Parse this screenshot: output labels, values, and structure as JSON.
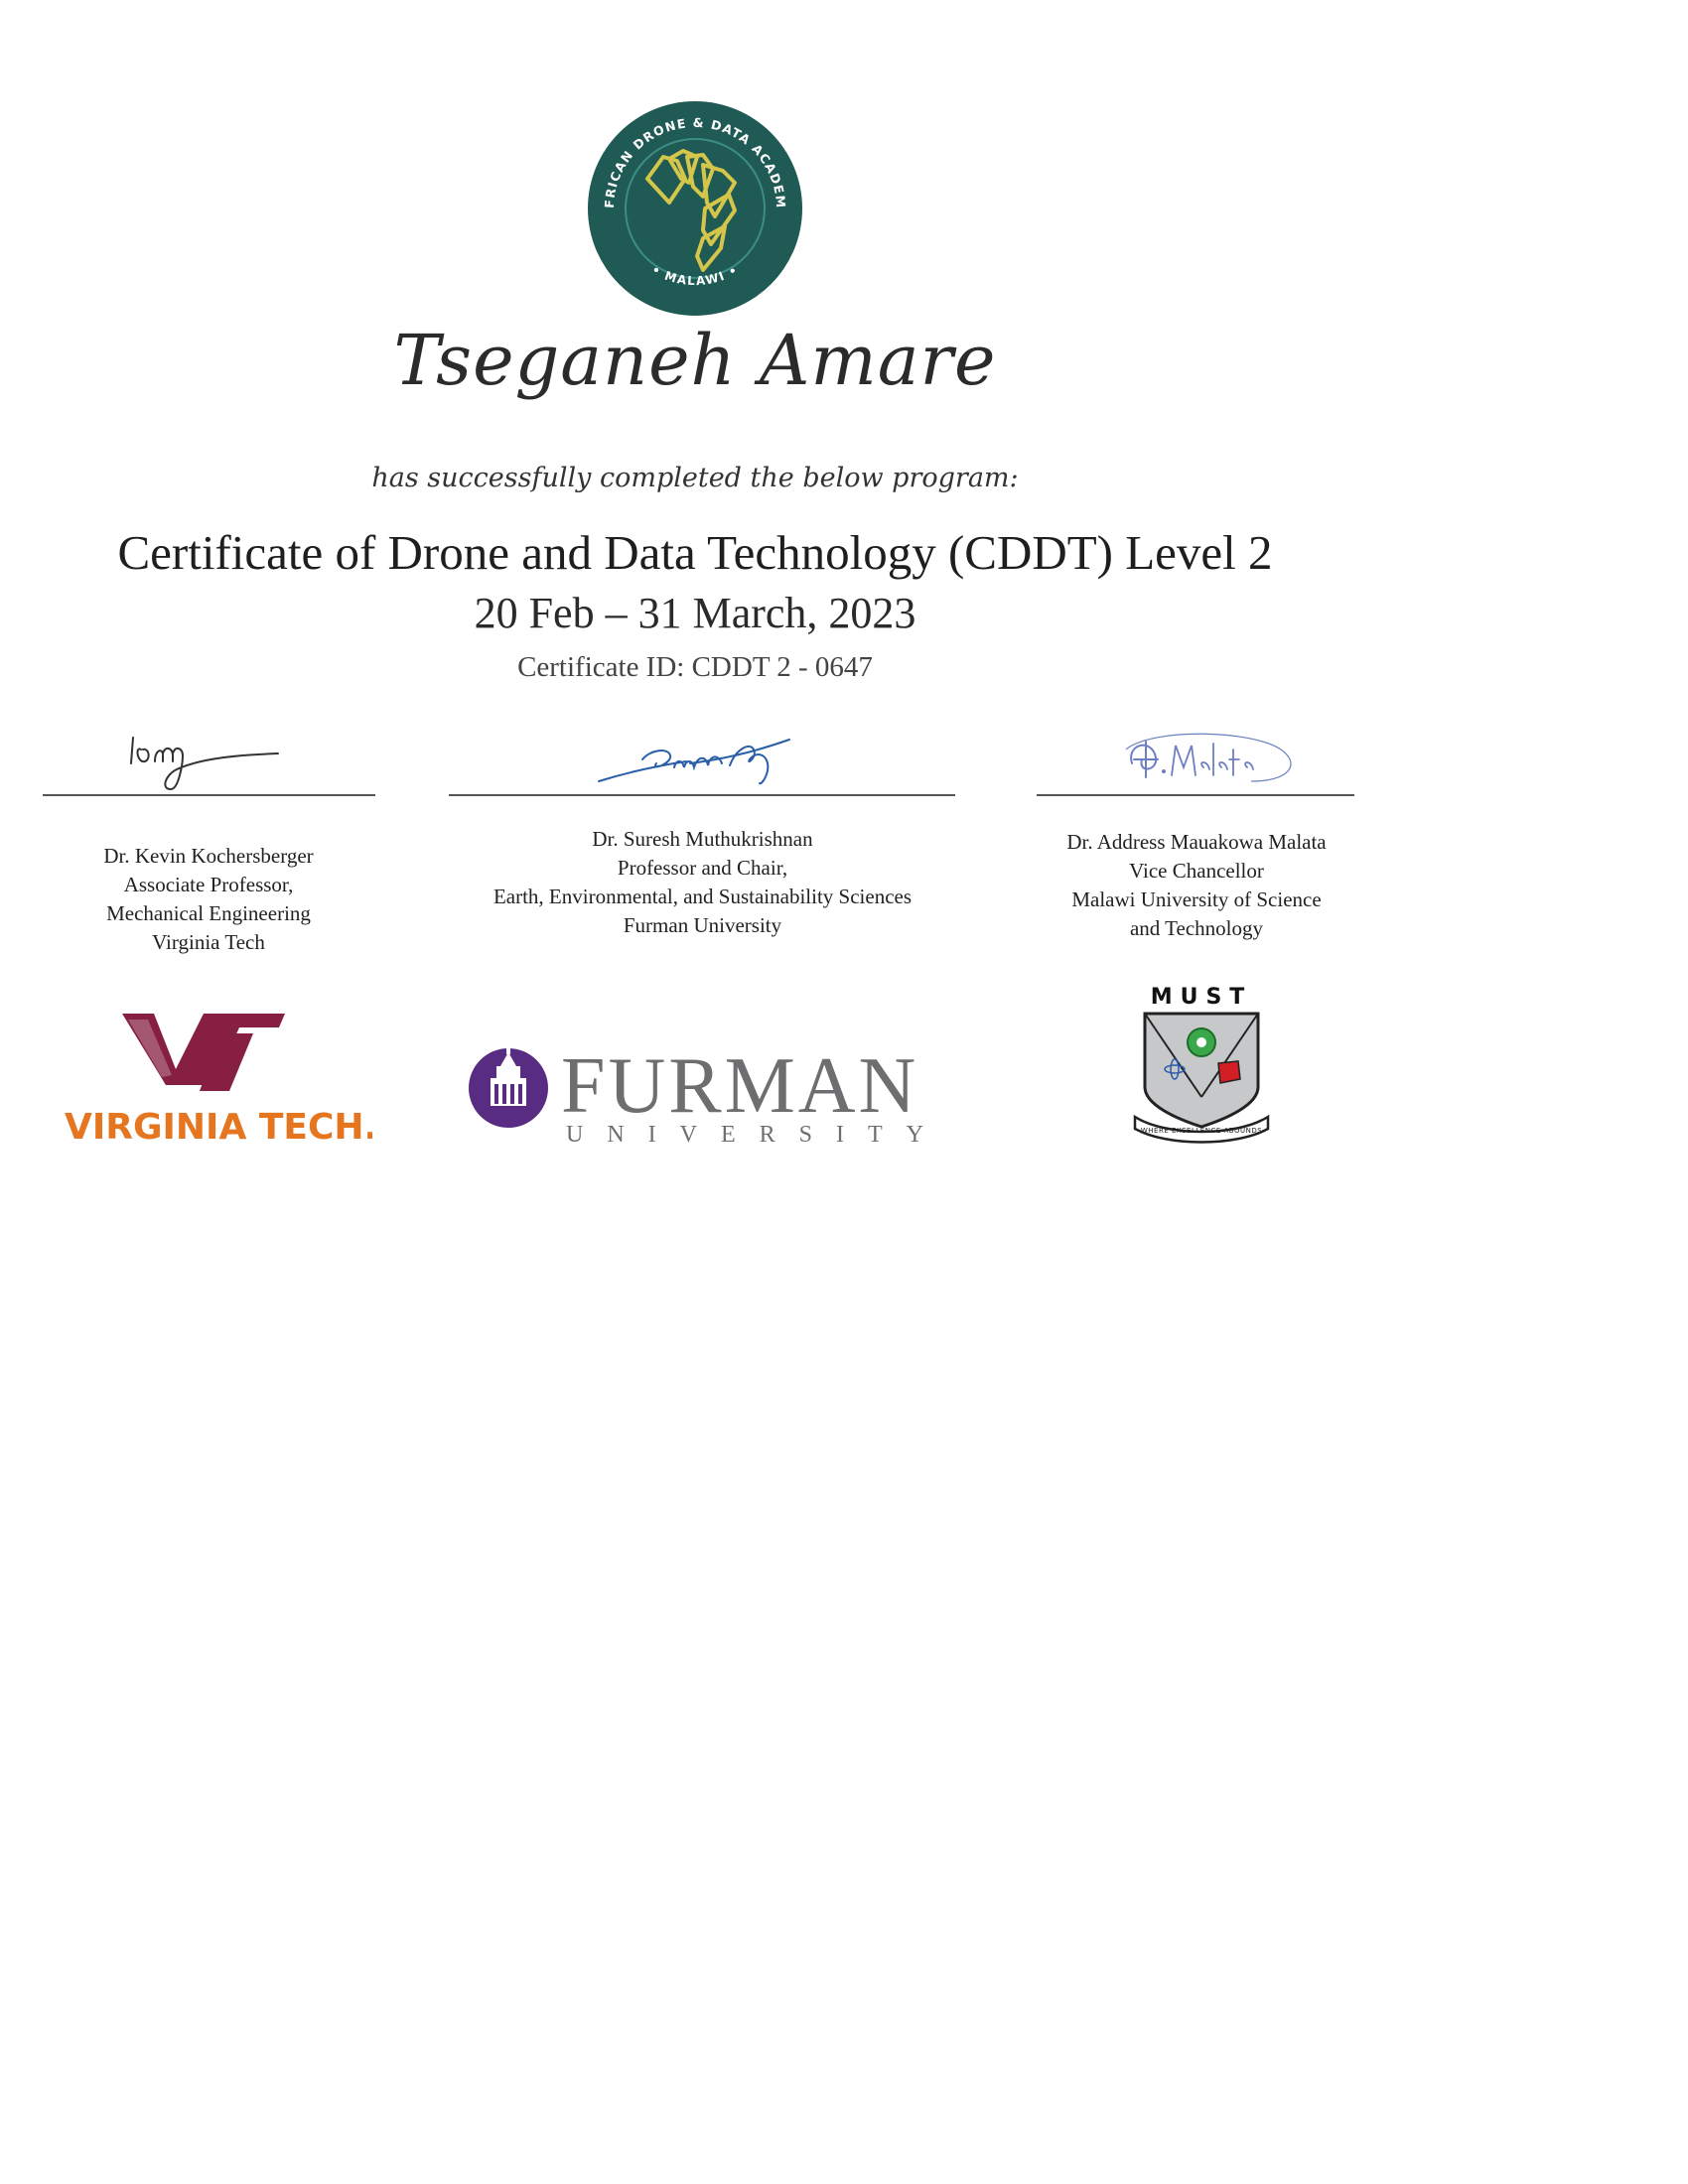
{
  "academy": {
    "seal_text": "AFRICAN DRONE & DATA ACADEMY",
    "seal_location": "MALAWI",
    "colors": {
      "seal": "#1f5a54",
      "accent": "#d4c64a"
    }
  },
  "certificate": {
    "recipient": "Tseganeh Amare",
    "completion_text": "has successfully completed the below program:",
    "program": "Certificate of Drone and Data Technology (CDDT) Level 2",
    "dates": "20 Feb – 31 March, 2023",
    "certificate_id": "Certificate ID: CDDT 2 - 0647"
  },
  "signatories": [
    {
      "name": "Dr. Kevin Kochersberger",
      "title_lines": [
        "Associate Professor,",
        "Mechanical Engineering",
        "Virginia Tech"
      ]
    },
    {
      "name": "Dr. Suresh Muthukrishnan",
      "title_lines": [
        "Professor and Chair,",
        "Earth, Environmental, and Sustainability Sciences",
        "Furman University"
      ]
    },
    {
      "name": "Dr. Address Mauakowa Malata",
      "title_lines": [
        "Vice Chancellor",
        "Malawi University of Science",
        "and Technology"
      ]
    }
  ],
  "logos": {
    "virginia_tech": {
      "text": "VIRGINIA TECH.",
      "monogram": "VT",
      "colors": {
        "maroon": "#861f41",
        "orange": "#e5751f"
      }
    },
    "furman": {
      "name": "FURMAN",
      "subtitle": "UNIVERSITY",
      "colors": {
        "purple": "#582c83",
        "gray": "#6d6e70"
      }
    },
    "must": {
      "acronym": "MUST",
      "motto": "WHERE EXCELLENCE ABOUNDS"
    }
  }
}
